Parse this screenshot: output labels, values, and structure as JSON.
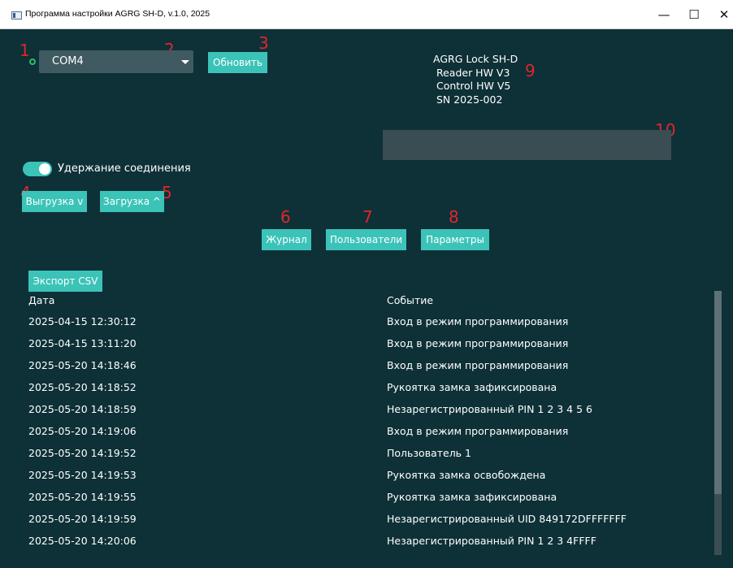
{
  "window": {
    "title": "Программа настройки AGRG SH-D, v.1.0, 2025",
    "minimize": "—",
    "maximize": "☐",
    "close": "✕"
  },
  "annotations": [
    "1",
    "2",
    "3",
    "4",
    "5",
    "6",
    "7",
    "8",
    "9",
    "10"
  ],
  "connection": {
    "port_value": "COM4",
    "refresh_label": "Обновить",
    "keep_alive_label": "Удержание соединения",
    "keep_alive_on": true
  },
  "device": {
    "info": "AGRG Lock SH-D\n Reader HW V3\n Control HW V5\n SN 2025-002"
  },
  "transfer": {
    "upload_label": "Выгрузка v",
    "download_label": "Загрузка ^"
  },
  "nav": {
    "log_label": "Журнал",
    "users_label": "Пользователи",
    "params_label": "Параметры"
  },
  "log": {
    "export_label": "Экспорт CSV",
    "col_date": "Дата",
    "col_event": "Событие",
    "rows": [
      {
        "date": "2025-04-15 12:30:12",
        "event": "Вход в режим программирования"
      },
      {
        "date": "2025-04-15 13:11:20",
        "event": "Вход в режим программирования"
      },
      {
        "date": "2025-05-20 14:18:46",
        "event": "Вход в режим программирования"
      },
      {
        "date": "2025-05-20 14:18:52",
        "event": "Рукоятка замка зафиксирована"
      },
      {
        "date": "2025-05-20 14:18:59",
        "event": "Незарегистрированный PIN 1 2 3 4 5 6"
      },
      {
        "date": "2025-05-20 14:19:06",
        "event": "Вход в режим программирования"
      },
      {
        "date": "2025-05-20 14:19:52",
        "event": "Пользователь 1"
      },
      {
        "date": "2025-05-20 14:19:53",
        "event": "Рукоятка замка освобождена"
      },
      {
        "date": "2025-05-20 14:19:55",
        "event": "Рукоятка замка зафиксирована"
      },
      {
        "date": "2025-05-20 14:19:59",
        "event": "Незарегистрированный UID 849172DFFFFFFF"
      },
      {
        "date": "2025-05-20 14:20:06",
        "event": "Незарегистрированный PIN 1 2 3 4FFFF"
      }
    ]
  },
  "colors": {
    "background": "#0e3037",
    "accent": "#3cc3b8",
    "annotation": "#e0262b",
    "status_led": "#29c067"
  }
}
